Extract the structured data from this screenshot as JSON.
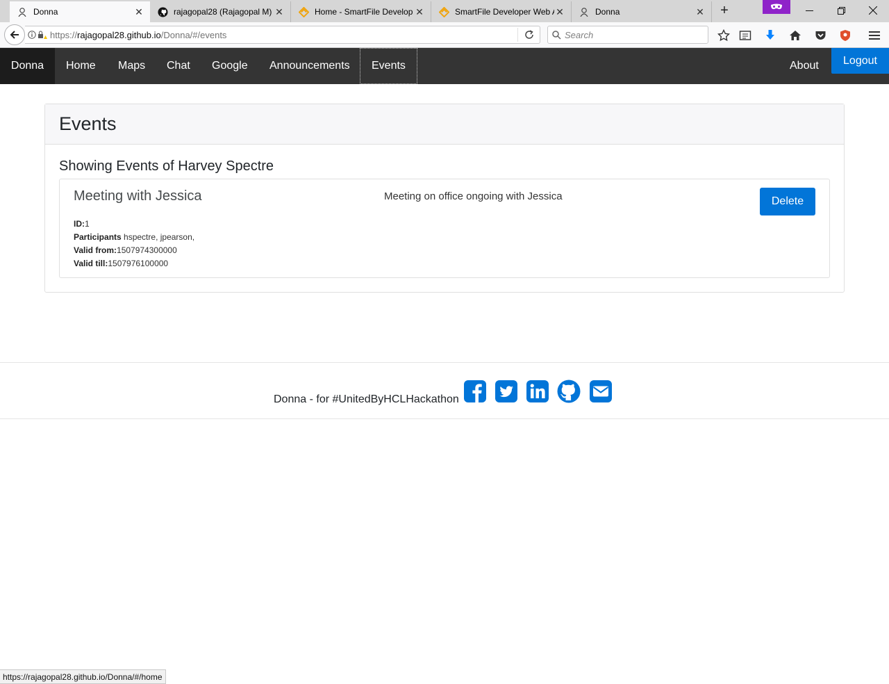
{
  "browser": {
    "tabs": [
      {
        "title": "Donna",
        "active": true
      },
      {
        "title": "rajagopal28 (Rajagopal M)",
        "active": false
      },
      {
        "title": "Home - SmartFile Develop",
        "active": false
      },
      {
        "title": "SmartFile Developer Web A",
        "active": false
      },
      {
        "title": "Donna",
        "active": false
      }
    ],
    "close_glyph": "✕",
    "new_tab_glyph": "+",
    "url_scheme": "https://",
    "url_host": "rajagopal28.github.io",
    "url_path": "/Donna/#/events",
    "search_placeholder": "Search",
    "status_url": "https://rajagopal28.github.io/Donna/#/home"
  },
  "nav": {
    "brand": "Donna",
    "links": [
      "Home",
      "Maps",
      "Chat",
      "Google",
      "Announcements",
      "Events"
    ],
    "about": "About",
    "logout": "Logout"
  },
  "page": {
    "title": "Events",
    "subtitle": "Showing Events of Harvey Spectre"
  },
  "events": [
    {
      "title": "Meeting with Jessica",
      "description": "Meeting on office ongoing with Jessica",
      "id_label": "ID:",
      "id": "1",
      "participants_label": "Participants",
      "participants": " hspectre, jpearson,",
      "valid_from_label": "Valid from:",
      "valid_from": "1507974300000",
      "valid_till_label": "Valid till:",
      "valid_till": "1507976100000",
      "delete_label": "Delete"
    }
  ],
  "footer": {
    "text": "Donna - for #UnitedByHCLHackathon",
    "social_icons": [
      "facebook-icon",
      "twitter-icon",
      "linkedin-icon",
      "github-icon",
      "envelope-icon"
    ]
  },
  "colors": {
    "primary": "#0275d8",
    "nav_bg": "#343434",
    "brand_bg": "#1c1c1c"
  }
}
